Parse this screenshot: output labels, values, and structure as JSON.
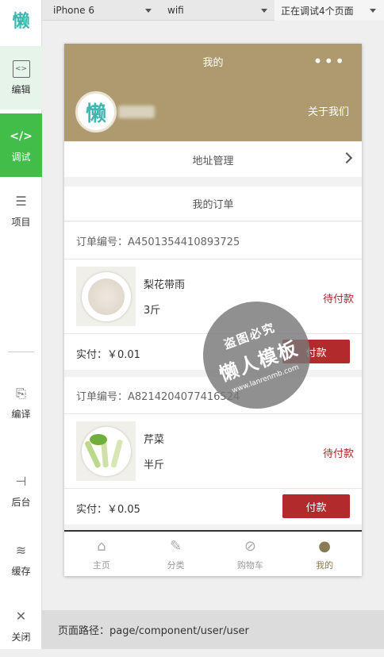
{
  "sidebar": {
    "logo": "懒",
    "items": [
      {
        "label": "编辑",
        "icon": "code-box-icon",
        "glyph": "<>"
      },
      {
        "label": "调试",
        "icon": "code-icon",
        "glyph": "</>"
      },
      {
        "label": "项目",
        "icon": "menu-icon",
        "glyph": "☰"
      },
      {
        "label": "编译",
        "icon": "compile-icon",
        "glyph": "⎘"
      },
      {
        "label": "后台",
        "icon": "backend-icon",
        "glyph": "⊣"
      },
      {
        "label": "缓存",
        "icon": "layers-icon",
        "glyph": "≋"
      },
      {
        "label": "关闭",
        "icon": "close-icon",
        "glyph": "✕"
      }
    ]
  },
  "toolbar": {
    "device": "iPhone 6",
    "network": "wifi",
    "pages": "正在调试4个页面"
  },
  "phone": {
    "header_title": "我的",
    "menu_dots": "•••",
    "avatar_text": "懒",
    "about": "关于我们",
    "address_label": "地址管理",
    "orders_title": "我的订单",
    "orders": [
      {
        "number": "订单编号：A4501354410893725",
        "name": "梨花带雨",
        "spec": "3斤",
        "status": "待付款",
        "paid": "实付：￥0.01",
        "button": "付款",
        "image": "rice-dish-image"
      },
      {
        "number": "订单编号：A8214204077416524",
        "name": "芹菜",
        "spec": "半斤",
        "status": "待付款",
        "paid": "实付：￥0.05",
        "button": "付款",
        "image": "celery-dish-image"
      }
    ],
    "tabs": [
      {
        "label": "主页",
        "icon": "home-icon",
        "glyph": "⌂"
      },
      {
        "label": "分类",
        "icon": "edit-icon",
        "glyph": "✎"
      },
      {
        "label": "购物车",
        "icon": "leaf-icon",
        "glyph": "⊘"
      },
      {
        "label": "我的",
        "icon": "user-icon",
        "glyph": "●"
      }
    ],
    "active_tab": "我的"
  },
  "watermark": {
    "line1": "盗图必究",
    "line2": "懒人模板",
    "line3": "www.lanrenmb.com"
  },
  "path_bar": "页面路径：page/component/user/user",
  "colors": {
    "header_bg": "#ad9a6e",
    "accent_green": "#43bd4a",
    "pay_button": "#b32a2c",
    "status_text": "#a8292b"
  }
}
